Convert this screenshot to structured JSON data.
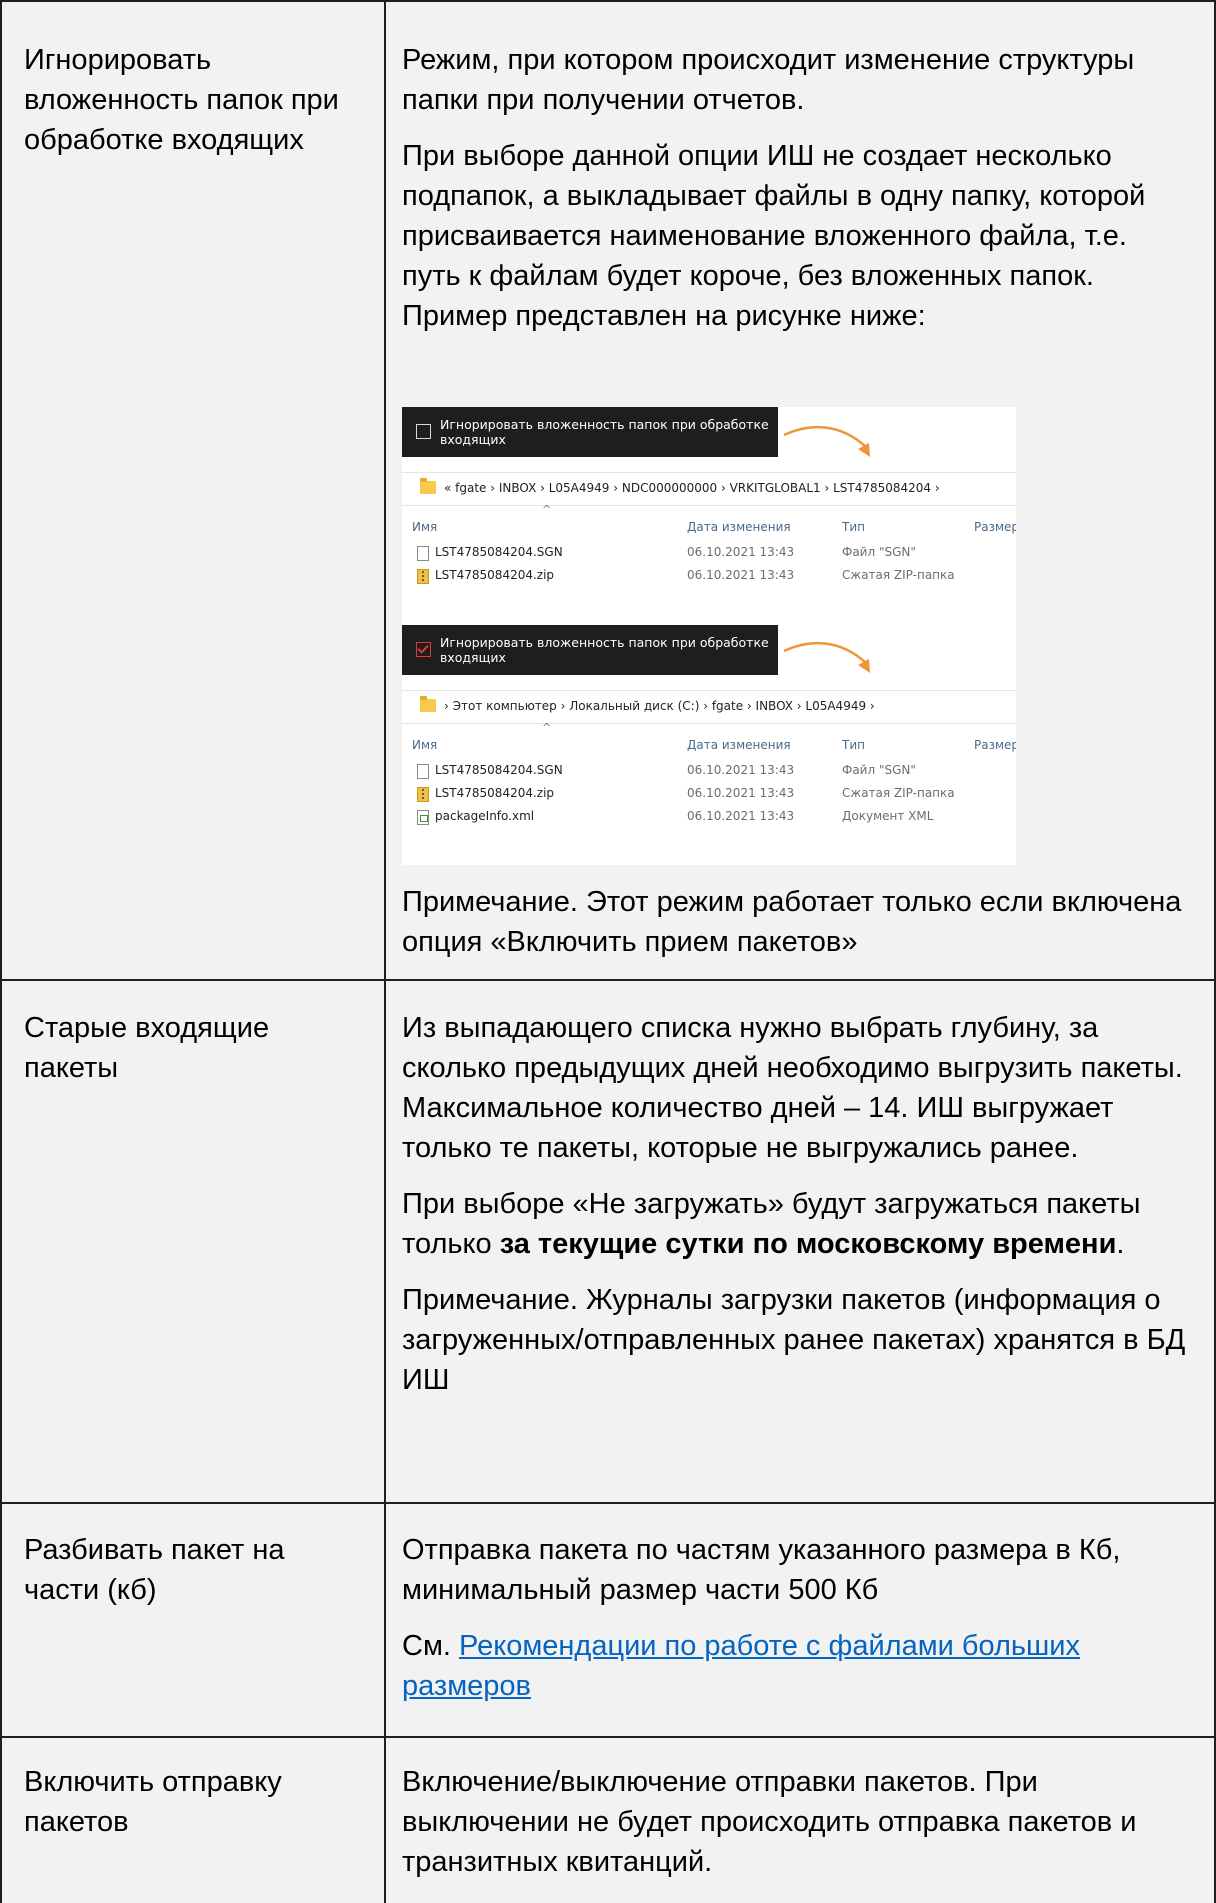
{
  "rows": [
    {
      "name": "Игнорировать вложенность папок при обработке входящих",
      "paragraphs": [
        "Режим, при котором происходит изменение структуры папки при получении отчетов.",
        "При выборе данной опции ИШ не создает несколько подпапок, а выкладывает файлы в одну папку, которой присваивается наименование вложенного файла, т.е. путь к файлам будет короче, без вложенных папок. Пример представлен на рисунке ниже:"
      ],
      "note": "Примечание. Этот режим работает только если включена опция «Включить прием пакетов»"
    },
    {
      "name": "Старые входящие пакеты",
      "p1": "Из выпадающего списка нужно выбрать глубину, за сколько предыдущих дней необходимо выгрузить пакеты. Максимальное количество дней – 14. ИШ выгружает только те пакеты, которые не выгружались ранее.",
      "p2_before": "При выборе «Не загружать» будут загружаться пакеты только ",
      "p2_bold": "за текущие сутки по московскому времени",
      "p2_after": ".",
      "p3": "Примечание. Журналы загрузки пакетов (информация о загруженных/отправленных ранее пакетах) хранятся в БД ИШ"
    },
    {
      "name": "Разбивать пакет на части (кб)",
      "p1": "Отправка пакета по частям указанного размера в Кб, минимальный размер части 500 Кб",
      "p2_prefix": "См. ",
      "p2_link": "Рекомендации по работе с файлами больших размеров"
    },
    {
      "name": "Включить отправку пакетов",
      "p1": "Включение/выключение отправки пакетов. При выключении не будет происходить отправка пакетов и транзитных квитанций."
    }
  ],
  "figure": {
    "top": {
      "checkbox_label": "Игнорировать вложенность папок при обработке входящих",
      "checked": false,
      "path": "« fgate › INBOX › L05A4949 › NDC000000000 › VRKITGLOBAL1 › LST4785084204 ›",
      "columns": [
        "Имя",
        "Дата изменения",
        "Тип",
        "Размер"
      ],
      "files": [
        {
          "icon": "doc",
          "name": "LST4785084204.SGN",
          "date": "06.10.2021 13:43",
          "type": "Файл \"SGN\""
        },
        {
          "icon": "zip",
          "name": "LST4785084204.zip",
          "date": "06.10.2021 13:43",
          "type": "Сжатая ZIP-папка"
        }
      ]
    },
    "bottom": {
      "checkbox_label": "Игнорировать вложенность папок при обработке входящих",
      "checked": true,
      "path": "› Этот компьютер › Локальный диск (C:) › fgate › INBOX › L05A4949 ›",
      "columns": [
        "Имя",
        "Дата изменения",
        "Тип",
        "Размер"
      ],
      "files": [
        {
          "icon": "doc",
          "name": "LST4785084204.SGN",
          "date": "06.10.2021 13:43",
          "type": "Файл \"SGN\""
        },
        {
          "icon": "zip",
          "name": "LST4785084204.zip",
          "date": "06.10.2021 13:43",
          "type": "Сжатая ZIP-папка"
        },
        {
          "icon": "xml",
          "name": "packageInfo.xml",
          "date": "06.10.2021 13:43",
          "type": "Документ XML"
        }
      ]
    }
  },
  "colors": {
    "cell_background": "#f2f2f2",
    "grid": "#1f1f1f",
    "link": "#0563c1",
    "arrow": "#f0943a",
    "checkbox_checked": "#e0383a"
  }
}
